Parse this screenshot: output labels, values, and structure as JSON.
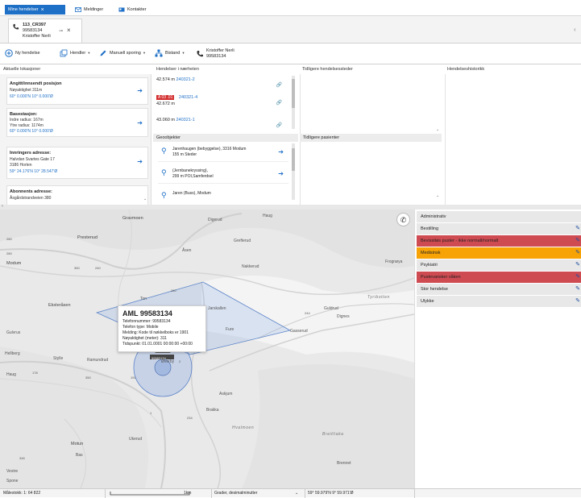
{
  "tabs": [
    {
      "label": "Mine hendelser",
      "active": true
    },
    {
      "label": "Meldinger",
      "active": false
    },
    {
      "label": "Kontakter",
      "active": false
    }
  ],
  "case": {
    "id": "113_CR397",
    "phone": "99583134",
    "name": "Kristoffer Nerli"
  },
  "toolbar": {
    "new_event": "Ny hendelse",
    "events": "Hendler",
    "manual_tracking": "Manuell sporing",
    "assistance": "Bistand",
    "caller_name": "Kristoffer Nerli",
    "caller_phone": "99583134"
  },
  "panels": {
    "current_locations": "Aktuelle lokasjoner",
    "nearby_events": "Hendelser i nærheten",
    "previous_places": "Tidligere hendelsessteder",
    "event_history": "Hendelseshistorikk",
    "geo_objects": "Geoobjekter",
    "previous_patients": "Tidligere pasienter"
  },
  "locations": [
    {
      "title": "Angitt/innsendt posisjon",
      "lines": [
        "Nøyaktighet 311m"
      ],
      "coord": "60° 0.000'N 10° 0.000'Ø"
    },
    {
      "title": "Basestasjon:",
      "lines": [
        "Indre radius: 167m",
        "Ytre radius: 1174m"
      ],
      "coord": "60° 0.000'N 10° 0.000'Ø"
    },
    {
      "title": "Innringers adresse:",
      "lines": [
        "Halvdan Svartes Gate 17",
        "3186 Horten"
      ],
      "coord": "59° 24.176'N 10° 28.547'Ø"
    },
    {
      "title": "Abonnents adresse:",
      "lines": [
        "Åsgårdstrandveien 380"
      ],
      "coord": ""
    }
  ],
  "nearby": [
    {
      "distance": "42.574 m",
      "badge": "",
      "id": "240321-2"
    },
    {
      "distance": "42.672 m",
      "badge": "A 03 .01",
      "id": "240321-4"
    },
    {
      "distance": "43.060 m",
      "badge": "",
      "id": "240321-1"
    }
  ],
  "geo_objects": [
    {
      "line1": "Jarenhaugen (bebyggelse), 3316 Modum",
      "line2": "155 m Steder"
    },
    {
      "line1": "(Jernbanekryssing),",
      "line2": "299 m POI,Samferdsel"
    },
    {
      "line1": "Jaren (Buss), Modum",
      "line2": ""
    }
  ],
  "popup": {
    "title": "AML 99583134",
    "lines": [
      "Telefonnummer: 99583134",
      "Telefon type: Mobile",
      "Melding: Kode til nøkkelboks er 1901",
      "Nøyaktighet (meter): 311",
      "Tidspunkt: 01.01.0001 00:00:00 +00:00"
    ]
  },
  "map_labels": {
    "gravmoen": "Gravmoen",
    "digerud": "Digerud",
    "haug": "Haug",
    "prestenud": "Prestenud",
    "greftenrud": "Grefterud",
    "modum": "Modum",
    "aasen": "Åsen",
    "nakkerud": "Nakkerud",
    "frognøya": "Frognøya",
    "tyribotten": "Tyribotten",
    "eksterasen": "Eksteråsen",
    "ton": "Ton",
    "jarskallen": "Jarskallen",
    "gulvrus": "Gulvrus",
    "gulbrandsrud": "Guldrud",
    "dignes": "Dignes",
    "fure": "Fure",
    "gasserud": "Gasserud",
    "hellberg": "Hellberg",
    "stylle": "Stylle",
    "ramundrud": "Ramundrud",
    "overby": "Øverby",
    "haug2": "Haug",
    "askjum": "Askjum",
    "brakka": "Brakka",
    "hvalmoen": "Hvalmoen",
    "breitliaka": "Breitliaka",
    "ukerud": "Ukerud",
    "motun": "Motun",
    "bas": "Bas",
    "brennet": "Brennet",
    "vestre": "Vestre",
    "spone": "Spone",
    "r280": "280",
    "r1": "280",
    "r350": "350",
    "r240": "240",
    "r244": "244",
    "r190": "190",
    "r2x": "2",
    "r178": "178",
    "r234": "234",
    "r1b": "1",
    "r280b": "280",
    "r191": "191",
    "r350b": "350",
    "r346": "346"
  },
  "marker_label": "99583134",
  "categories": [
    {
      "label": "Administrativ",
      "color": "#e8e8e8"
    },
    {
      "label": "Bestilling",
      "color": "#e8e8e8"
    },
    {
      "label": "Bevisstløs puster - ikke normalt/normalt",
      "color": "#cf4b52"
    },
    {
      "label": "Medisinsk",
      "color": "#f7a205"
    },
    {
      "label": "Psykiatri",
      "color": "#e8e8e8"
    },
    {
      "label": "Pustevansker våken",
      "color": "#cf4b52"
    },
    {
      "label": "Stor hendelse",
      "color": "#e8e8e8"
    },
    {
      "label": "Ulykke",
      "color": "#e8e8e8"
    }
  ],
  "statusbar": {
    "scale": "Målestokk: 1: 64 822",
    "scalebar_unit": "1km",
    "coord_format": "Grader, desimalminutter",
    "cursor_coord": "59° 59.979'N 9° 59.971'Ø"
  },
  "colors": {
    "accent": "#1e6fc6",
    "red": "#cf4b52",
    "orange": "#f7a205"
  }
}
